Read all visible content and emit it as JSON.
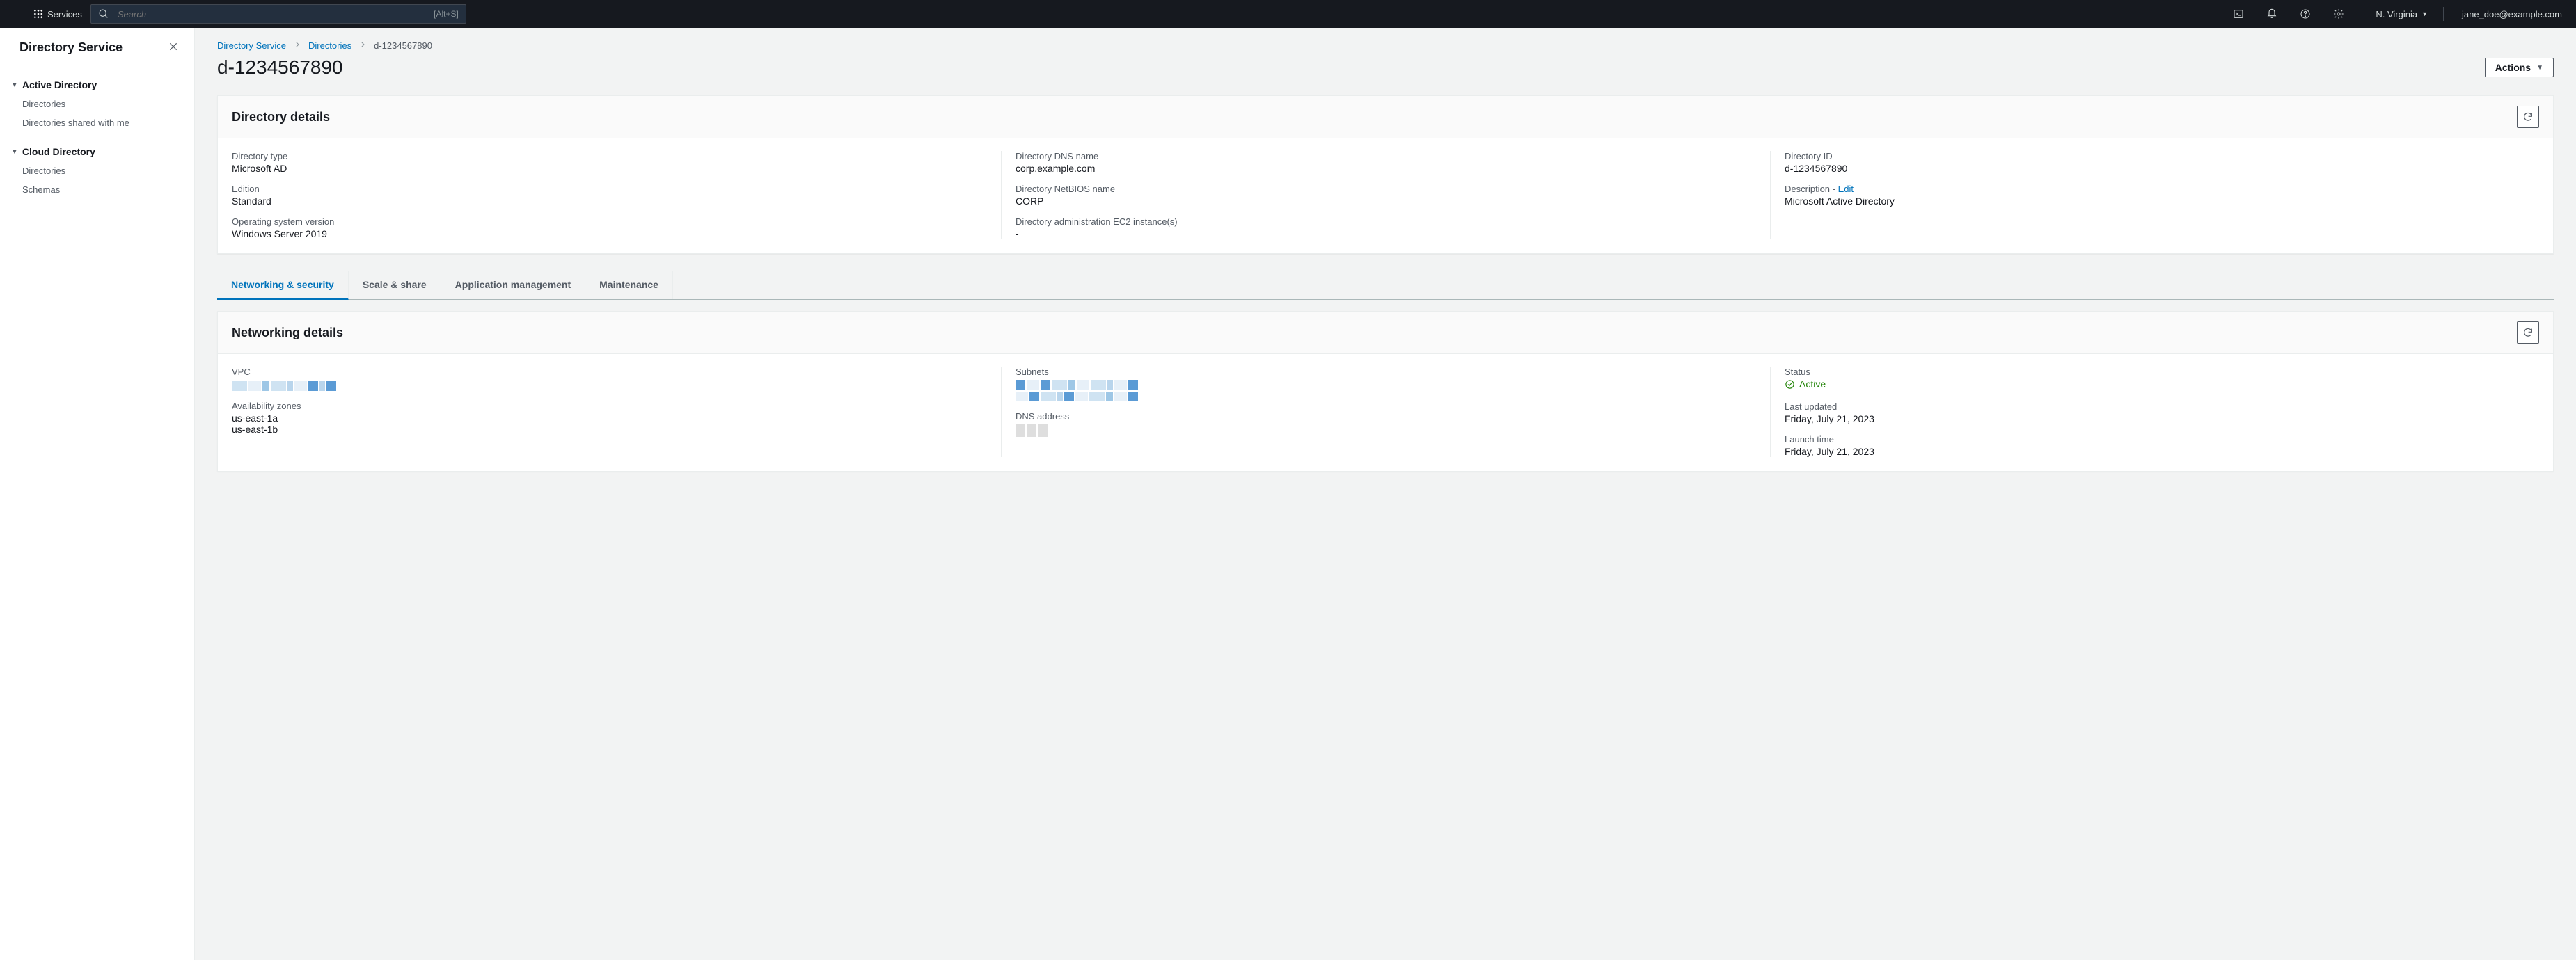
{
  "header": {
    "services_label": "Services",
    "search_placeholder": "Search",
    "search_kbd": "[Alt+S]",
    "region": "N. Virginia",
    "user": "jane_doe@example.com"
  },
  "sidenav": {
    "title": "Directory Service",
    "sections": [
      {
        "label": "Active Directory",
        "items": [
          "Directories",
          "Directories shared with me"
        ]
      },
      {
        "label": "Cloud Directory",
        "items": [
          "Directories",
          "Schemas"
        ]
      }
    ]
  },
  "crumbs": {
    "a": "Directory Service",
    "b": "Directories",
    "c": "d-1234567890"
  },
  "page": {
    "title": "d-1234567890",
    "actions_label": "Actions"
  },
  "details": {
    "panel_title": "Directory details",
    "col1": {
      "type_k": "Directory type",
      "type_v": "Microsoft AD",
      "edition_k": "Edition",
      "edition_v": "Standard",
      "os_k": "Operating system version",
      "os_v": "Windows Server 2019"
    },
    "col2": {
      "dns_k": "Directory DNS name",
      "dns_v": "corp.example.com",
      "nb_k": "Directory NetBIOS name",
      "nb_v": "CORP",
      "admin_k": "Directory administration EC2 instance(s)",
      "admin_v": "-"
    },
    "col3": {
      "id_k": "Directory ID",
      "id_v": "d-1234567890",
      "desc_k": "Description - ",
      "desc_edit": "Edit",
      "desc_v": "Microsoft Active Directory"
    }
  },
  "tabs": {
    "t1": "Networking & security",
    "t2": "Scale & share",
    "t3": "Application management",
    "t4": "Maintenance"
  },
  "network": {
    "panel_title": "Networking details",
    "col1": {
      "vpc_k": "VPC",
      "az_k": "Availability zones",
      "az_v1": "us-east-1a",
      "az_v2": "us-east-1b"
    },
    "col2": {
      "sub_k": "Subnets",
      "dns_k": "DNS address"
    },
    "col3": {
      "status_k": "Status",
      "status_v": "Active",
      "updated_k": "Last updated",
      "updated_v": "Friday, July 21, 2023",
      "launch_k": "Launch time",
      "launch_v": "Friday, July 21, 2023"
    }
  }
}
